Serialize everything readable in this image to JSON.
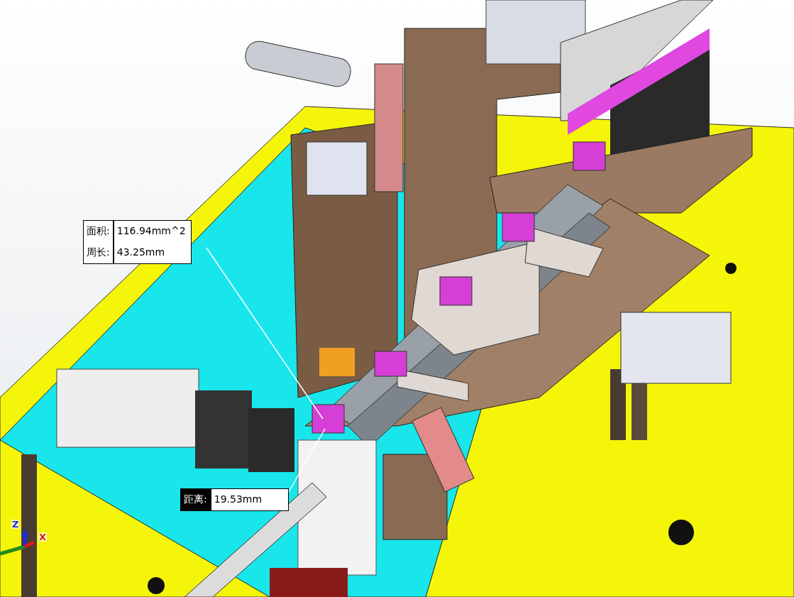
{
  "viewport": {
    "callouts": [
      {
        "kind": "area-perimeter",
        "label_active": false,
        "rows": [
          {
            "label": "面积:",
            "value": "116.94mm^2"
          },
          {
            "label": "周长:",
            "value": "43.25mm"
          }
        ]
      },
      {
        "kind": "distance",
        "label_active": true,
        "rows": [
          {
            "label": "距离:",
            "value": "19.53mm"
          }
        ]
      }
    ],
    "triad": {
      "axes": [
        {
          "kind": "z",
          "label": "Z"
        },
        {
          "kind": "x",
          "label": "X"
        }
      ]
    }
  }
}
